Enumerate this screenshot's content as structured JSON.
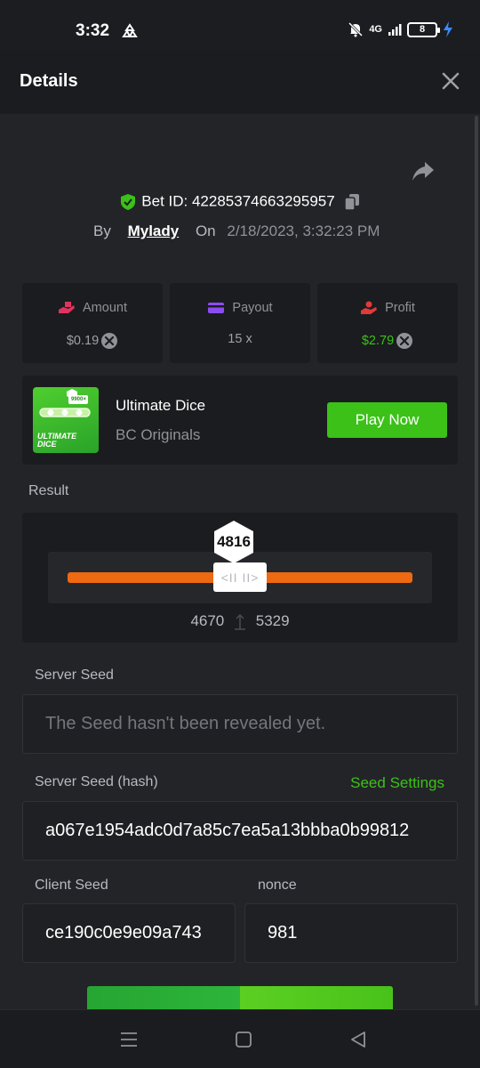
{
  "status_bar": {
    "time": "3:32",
    "network": "4G",
    "battery": "8"
  },
  "header": {
    "title": "Details"
  },
  "bet": {
    "id_label": "Bet ID: 42285374663295957",
    "by_label": "By",
    "username": "Mylady",
    "on_label": "On",
    "date": "2/18/2023, 3:32:23 PM"
  },
  "stats": {
    "amount_label": "Amount",
    "amount_value": "$0.19",
    "payout_label": "Payout",
    "payout_value": "15 x",
    "profit_label": "Profit",
    "profit_value": "$2.79",
    "profit_color": "#3bc117"
  },
  "game": {
    "name": "Ultimate Dice",
    "provider": "BC Originals",
    "thumb_line1": "ULTIMATE",
    "thumb_line2": "DICE",
    "thumb_badge": "9900×",
    "play_label": "Play Now"
  },
  "result": {
    "label": "Result",
    "value": "4816",
    "range_low": "4670",
    "range_high": "5329",
    "handle_glyph": "<II II>"
  },
  "server_seed": {
    "label": "Server Seed",
    "placeholder": "The Seed hasn't been revealed yet."
  },
  "server_seed_hash": {
    "label": "Server Seed (hash)",
    "value": "a067e1954adc0d7a85c7ea5a13bbba0b99812",
    "settings_link": "Seed Settings"
  },
  "client_seed": {
    "label": "Client Seed",
    "value": "ce190c0e9e09a743"
  },
  "nonce": {
    "label": "nonce",
    "value": "981"
  },
  "colors": {
    "accent_green": "#3bc117",
    "track_orange": "#ed6a12",
    "background": "#232428"
  }
}
